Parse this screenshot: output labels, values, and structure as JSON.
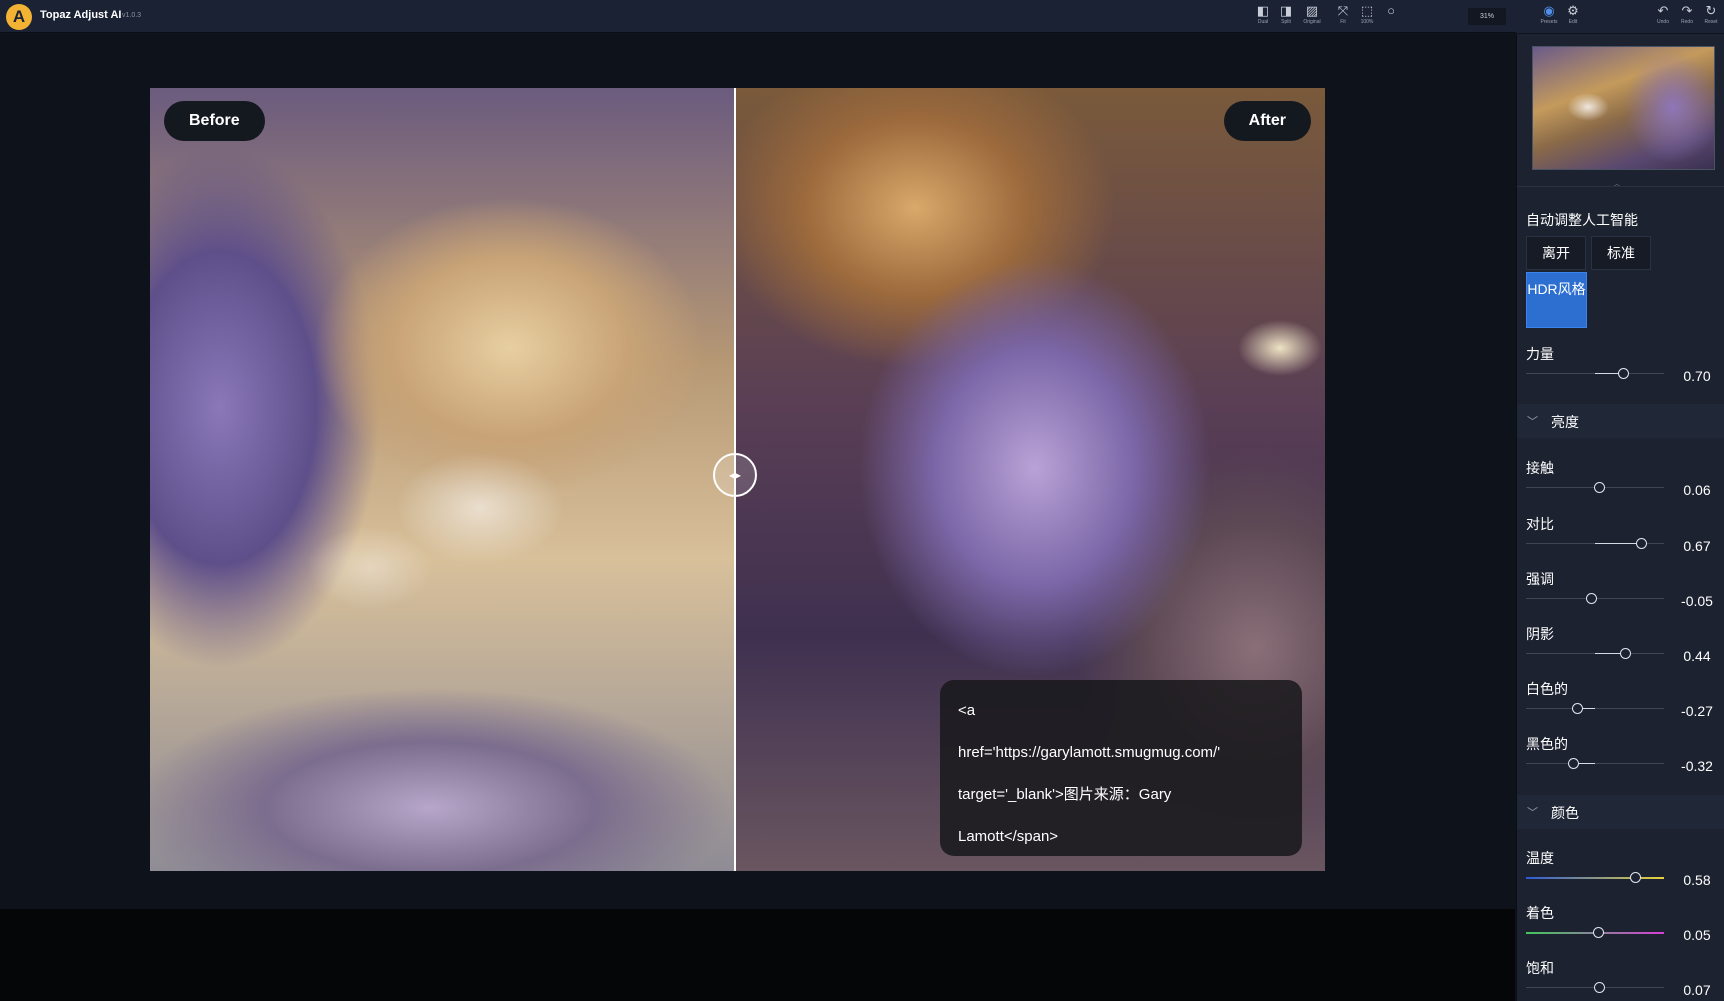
{
  "app": {
    "logo_letter": "A",
    "title": "Topaz Adjust AI",
    "version": "v1.0.3"
  },
  "toolbar": {
    "view_dual": "Dual",
    "view_split": "Split",
    "view_original": "Original",
    "fit": "Fit",
    "zoom_100": "100%",
    "zoom_value": "31%"
  },
  "side_toolbar": {
    "presets": "Presets",
    "edit": "Edit",
    "undo": "Undo",
    "redo": "Redo",
    "reset": "Reset"
  },
  "preview": {
    "before_label": "Before",
    "after_label": "After",
    "split_position": 0.498,
    "caption_lines": [
      "<a",
      "href='https://garylamott.smugmug.com/'",
      "target='_blank'>图片来源：Gary",
      "Lamott</span>"
    ]
  },
  "panel": {
    "auto_title": "自动调整人工智能",
    "modes": [
      "离开",
      "标准",
      "HDR风格"
    ],
    "active_mode": "HDR风格",
    "strength": {
      "label": "力量",
      "value": "0.70",
      "fraction": 0.7
    },
    "brightness_group": "亮度",
    "brightness_sliders": [
      {
        "label": "接触",
        "value": "0.06",
        "fraction": 0.53
      },
      {
        "label": "对比",
        "value": "0.67",
        "fraction": 0.83
      },
      {
        "label": "强调",
        "value": "-0.05",
        "fraction": 0.47
      },
      {
        "label": "阴影",
        "value": "0.44",
        "fraction": 0.72
      },
      {
        "label": "白色的",
        "value": "-0.27",
        "fraction": 0.37
      },
      {
        "label": "黑色的",
        "value": "-0.32",
        "fraction": 0.34
      }
    ],
    "color_group": "颜色",
    "color_sliders": [
      {
        "label": "温度",
        "value": "0.58",
        "fraction": 0.79
      },
      {
        "label": "着色",
        "value": "0.05",
        "fraction": 0.52
      },
      {
        "label": "饱和",
        "value": "0.07",
        "fraction": 0.53
      }
    ]
  },
  "colors": {
    "accent": "#2c6fd1",
    "topbar": "#1b2233",
    "panel": "#1c2230",
    "logo": "#f2b233"
  },
  "icons": [
    "app-logo-icon",
    "dual-view-icon",
    "split-view-icon",
    "original-view-icon",
    "fit-icon",
    "zoom-100-icon",
    "grid-dot-icon",
    "presets-icon",
    "edit-icon",
    "undo-icon",
    "redo-icon",
    "reset-icon",
    "chevron-down-icon",
    "split-handle-icon"
  ]
}
